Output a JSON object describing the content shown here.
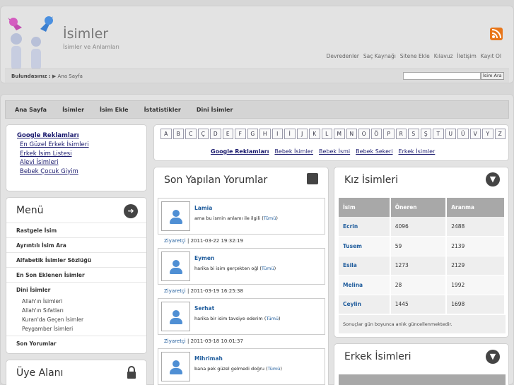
{
  "header": {
    "title": "İsimler",
    "subtitle": "İsimler ve Anlamları",
    "links": [
      "Devredenler",
      "Saç Kaynağı",
      "Sitene Ekle",
      "Kılavuz",
      "İletişim",
      "Kayıt Ol"
    ],
    "breadcrumb_label": "Bulundasınız :",
    "breadcrumb_current": "Ana Sayfa",
    "search_button": "İsim Ara"
  },
  "nav": [
    "Ana Sayfa",
    "İsimler",
    "İsim Ekle",
    "İstatistikler",
    "Dini İsimler"
  ],
  "ads": {
    "title": "Google Reklamları",
    "links": [
      "En Güzel Erkek İsimleri",
      "Erkek İsim Listesi",
      "Alevi İsimleri",
      "Bebek Çocuk Giyim"
    ]
  },
  "menu": {
    "title": "Menü",
    "items": [
      "Rastgele İsim",
      "Ayrıntılı İsim Ara",
      "Alfabetik İsimler Sözlüğü",
      "En Son Eklenen İsimler",
      "Dini İsimler"
    ],
    "subitems": [
      "Allah'ın İsimleri",
      "Allah'ın Sıfatları",
      "Kuran'da Geçen İsimler",
      "Peygamber İsimleri"
    ],
    "last": "Son Yorumlar"
  },
  "uye": {
    "title": "Üye Alanı"
  },
  "alphabet": [
    "A",
    "B",
    "C",
    "Ç",
    "D",
    "E",
    "F",
    "G",
    "H",
    "I",
    "İ",
    "J",
    "K",
    "L",
    "M",
    "N",
    "O",
    "Ö",
    "P",
    "R",
    "S",
    "Ş",
    "T",
    "U",
    "Ü",
    "V",
    "Y",
    "Z"
  ],
  "alpha_links": [
    "Google Reklamları",
    "Bebek İsimler",
    "Bebek İsmi",
    "Bebek Sekeri",
    "Erkek İsimler"
  ],
  "comments": {
    "title": "Son Yapılan Yorumlar",
    "items": [
      {
        "name": "Lamia",
        "text": "ama bu ismin anlamı ile ilgili",
        "more": "Tümü",
        "who": "Ziyaretçi",
        "when": "2011-03-22 19:32:19"
      },
      {
        "name": "Eymen",
        "text": "harika bi isim gerçekten oğl",
        "more": "Tümü",
        "who": "Ziyaretçi",
        "when": "2011-03-19 16:25:38"
      },
      {
        "name": "Serhat",
        "text": "harika bir isim tavsiye ederim",
        "more": "Tümü",
        "who": "Ziyaretçi",
        "when": "2011-03-18 10:01:37"
      },
      {
        "name": "Mihrimah",
        "text": "bana pek güzel gelmedi doğru",
        "more": "Tümü",
        "who": "",
        "when": ""
      }
    ]
  },
  "kiz": {
    "title": "Kız İsimleri",
    "columns": [
      "İsim",
      "Öneren",
      "Aranma"
    ],
    "rows": [
      [
        "Ecrin",
        "4096",
        "2488"
      ],
      [
        "Tusem",
        "59",
        "2139"
      ],
      [
        "Esila",
        "1273",
        "2129"
      ],
      [
        "Melina",
        "28",
        "1992"
      ],
      [
        "Ceylin",
        "1445",
        "1698"
      ]
    ],
    "note": "Sonuçlar gün boyunca anlık güncellenmektedir."
  },
  "erkek": {
    "title": "Erkek İsimleri"
  }
}
